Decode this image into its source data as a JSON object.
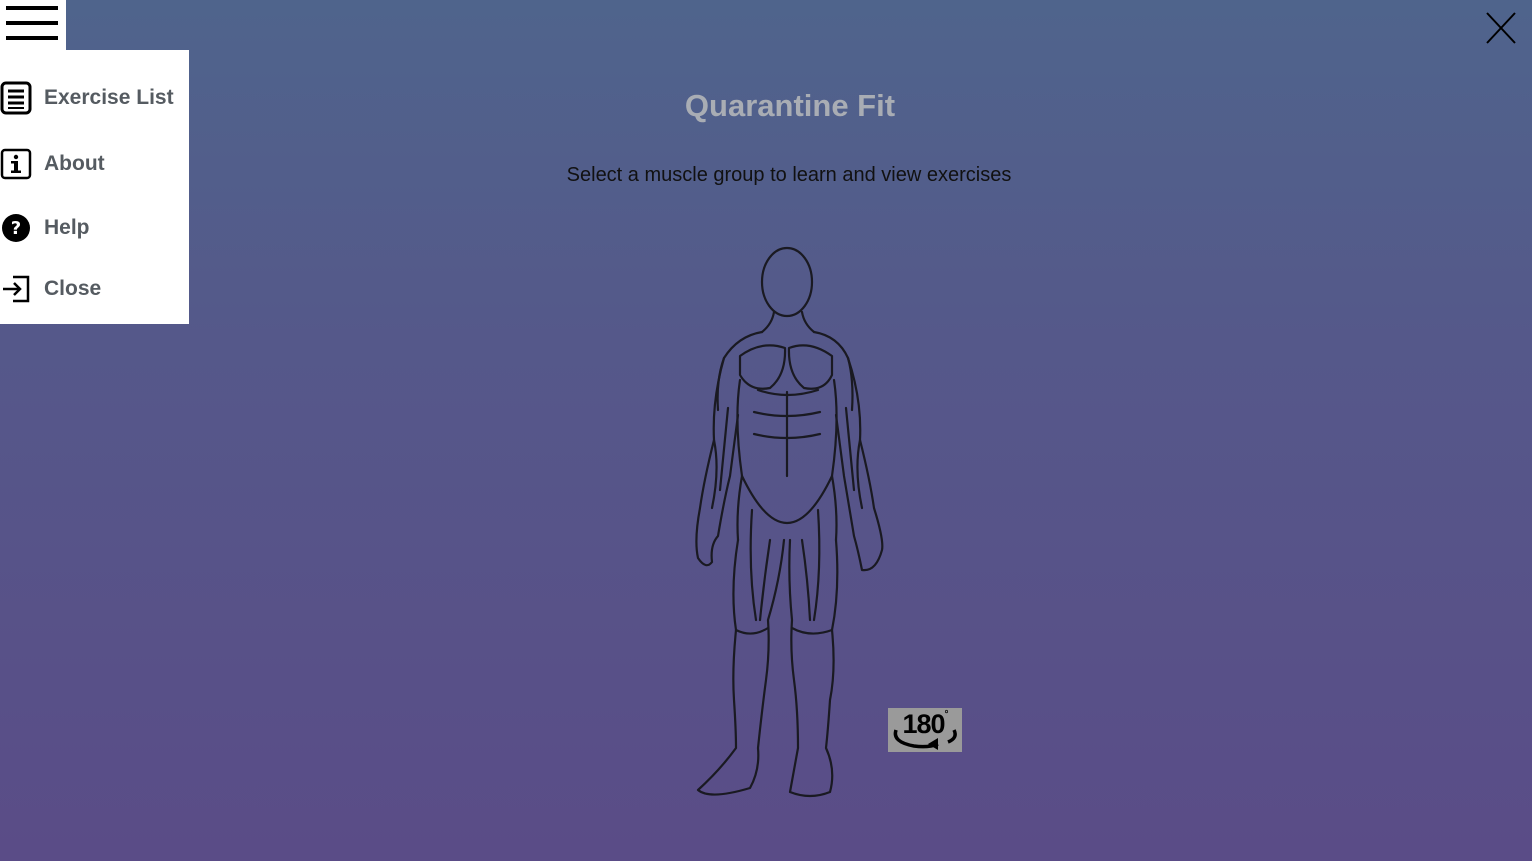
{
  "header": {
    "title": "Quarantine Fit",
    "subtitle": "Select a muscle group to learn and view exercises"
  },
  "menu": {
    "toggle_icon": "hamburger-icon",
    "items": [
      {
        "label": "Exercise List",
        "icon": "list-icon"
      },
      {
        "label": "About",
        "icon": "info-icon"
      },
      {
        "label": "Help",
        "icon": "help-icon"
      },
      {
        "label": "Close",
        "icon": "exit-icon"
      }
    ]
  },
  "close_button": {
    "icon": "close-icon"
  },
  "rotate_button": {
    "label": "180",
    "degree_symbol": "°",
    "icon": "rotate-icon"
  },
  "figure": {
    "icon": "human-body-front"
  },
  "colors": {
    "background_top": "#4f648c",
    "background_bottom": "#5a4c87",
    "title": "#a9adb4",
    "menu_label": "#555b61",
    "menu_bg": "#ffffff"
  }
}
